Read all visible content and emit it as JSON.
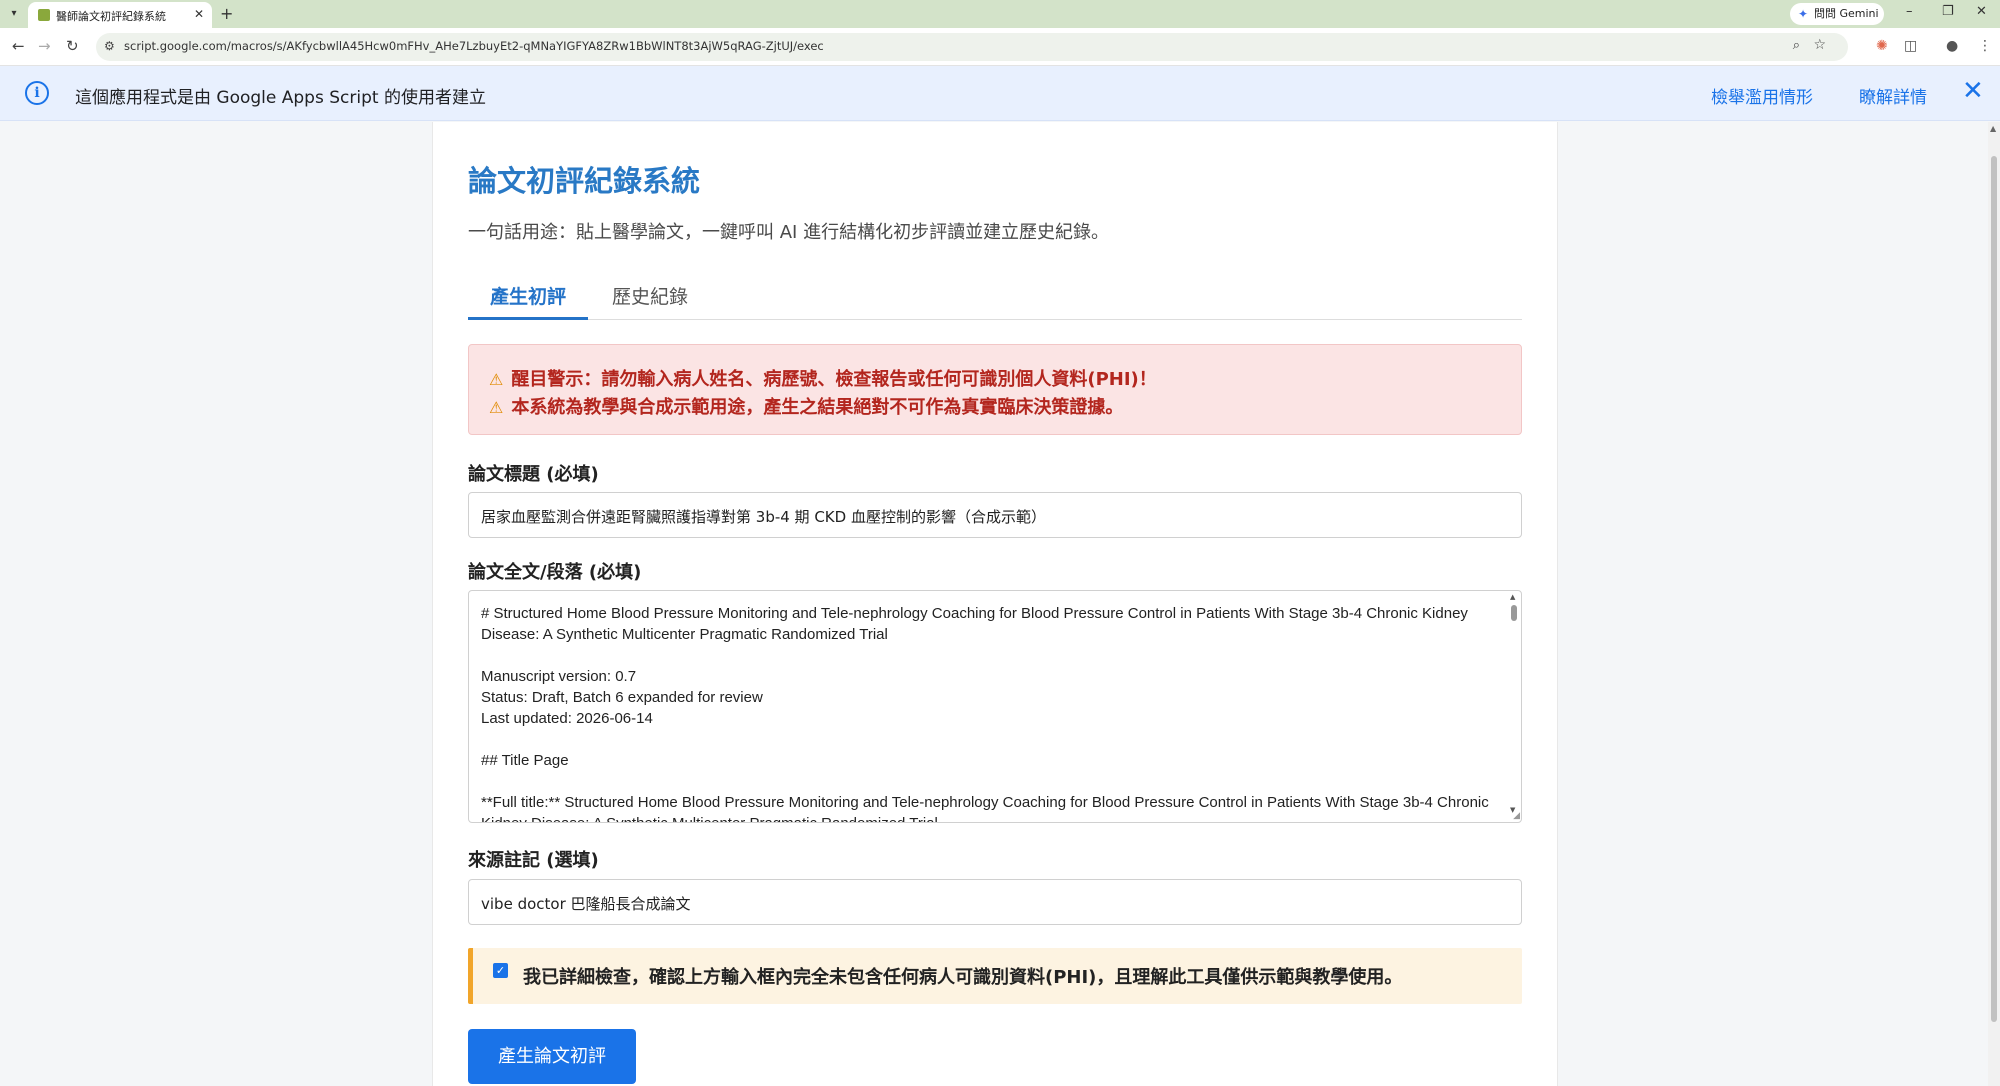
{
  "browser": {
    "tab_title": "醫師論文初評紀錄系統",
    "tab_close": "✕",
    "new_tab": "+",
    "url": "script.google.com/macros/s/AKfycbwllA45Hcw0mFHv_AHe7LzbuyEt2-qMNaYIGFYA8ZRw1BbWlNT8t3AjW5qRAG-ZjtUJ/exec",
    "gemini_label": "問問 Gemini",
    "icons": [
      "tab-search-icon",
      "back-icon",
      "forward-icon",
      "reload-icon",
      "site-info-icon",
      "zoom-icon",
      "bookmark-star-icon",
      "extension-icon",
      "puzzle-icon",
      "profile-icon",
      "kebab-menu-icon",
      "minimize-icon",
      "restore-icon",
      "close-window-icon"
    ]
  },
  "infobar": {
    "message": "這個應用程式是由 Google Apps Script 的使用者建立",
    "report_link": "檢舉濫用情形",
    "learn_link": "瞭解詳情",
    "close": "✕"
  },
  "page": {
    "title": "論文初評紀錄系統",
    "subtitle": "一句話用途：貼上醫學論文，一鍵呼叫 AI 進行結構化初步評讀並建立歷史紀錄。",
    "tabs": [
      {
        "label": "產生初評",
        "active": true
      },
      {
        "label": "歷史紀錄",
        "active": false
      }
    ],
    "alert_lines": [
      "醒目警示：請勿輸入病人姓名、病歷號、檢查報告或任何可識別個人資料(PHI)！",
      "本系統為教學與合成示範用途，產生之結果絕對不可作為真實臨床決策證據。"
    ],
    "title_field": {
      "label": "論文標題 (必填)",
      "value": "居家血壓監測合併遠距腎臟照護指導對第 3b-4 期 CKD 血壓控制的影響（合成示範）"
    },
    "body_field": {
      "label": "論文全文/段落 (必填)",
      "value": "# Structured Home Blood Pressure Monitoring and Tele-nephrology Coaching for Blood Pressure Control in Patients With Stage 3b-4 Chronic Kidney Disease: A Synthetic Multicenter Pragmatic Randomized Trial\n\nManuscript version: 0.7\nStatus: Draft, Batch 6 expanded for review\nLast updated: 2026-06-14\n\n## Title Page\n\n**Full title:** Structured Home Blood Pressure Monitoring and Tele-nephrology Coaching for Blood Pressure Control in Patients With Stage 3b-4 Chronic Kidney Disease: A Synthetic Multicenter Pragmatic Randomized Trial"
    },
    "source_field": {
      "label": "來源註記 (選填)",
      "value": "vibe doctor 巴隆船長合成論文"
    },
    "confirm": {
      "checked": true,
      "text": "我已詳細檢查，確認上方輸入框內完全未包含任何病人可識別資料(PHI)，且理解此工具僅供示範與教學使用。"
    },
    "submit_label": "產生論文初評"
  },
  "colors": {
    "accent": "#1a73e8",
    "title": "#2979c5",
    "alert_bg": "#fbe4e4",
    "alert_text": "#b3261e",
    "warn_icon": "#e08a00",
    "confirm_bg": "#fdf3e1",
    "confirm_border": "#f1a52a"
  }
}
